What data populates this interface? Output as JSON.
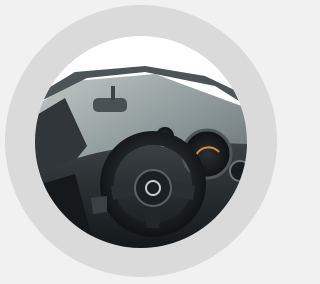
{
  "image": {
    "subject": "car-interior-photo",
    "colors": {
      "page_background": "#f1f1f1",
      "ring": "#dadada",
      "interior_dark": "#1e2225",
      "windshield": "#9aa4a5"
    }
  }
}
